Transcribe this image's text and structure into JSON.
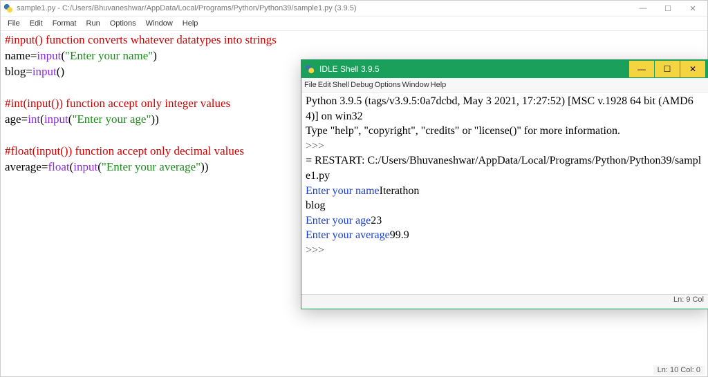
{
  "editor": {
    "title": "sample1.py - C:/Users/Bhuvaneshwar/AppData/Local/Programs/Python/Python39/sample1.py (3.9.5)",
    "menu": [
      "File",
      "Edit",
      "Format",
      "Run",
      "Options",
      "Window",
      "Help"
    ],
    "win_controls": {
      "min": "—",
      "max": "☐",
      "close": "✕"
    },
    "code": {
      "l1_comment": "#input() function converts whatever datatypes into strings",
      "l2_a": "name",
      "l2_b": "=",
      "l2_c": "input",
      "l2_d": "(",
      "l2_e": "\"Enter your name\"",
      "l2_f": ")",
      "l3_a": "blog",
      "l3_b": "=",
      "l3_c": "input",
      "l3_d": "(",
      "l3_e": ")",
      "l5_comment": "#int(input()) function accept only integer values",
      "l6_a": "age",
      "l6_b": "=",
      "l6_c": "int",
      "l6_d": "(",
      "l6_e": "input",
      "l6_f": "(",
      "l6_g": "\"Enter your age\"",
      "l6_h": ")",
      "l6_i": ")",
      "l8_comment": "#float(input()) function accept only decimal values",
      "l9_a": "average",
      "l9_b": "=",
      "l9_c": "float",
      "l9_d": "(",
      "l9_e": "input",
      "l9_f": "(",
      "l9_g": "\"Enter your average\"",
      "l9_h": ")",
      "l9_i": ")"
    },
    "status": "Ln: 10  Col: 0"
  },
  "shell": {
    "title": "IDLE Shell 3.9.5",
    "menu": [
      "File",
      "Edit",
      "Shell",
      "Debug",
      "Options",
      "Window",
      "Help"
    ],
    "win_controls": {
      "min": "—",
      "max": "☐",
      "close": "✕"
    },
    "banner1": "Python 3.9.5 (tags/v3.9.5:0a7dcbd, May  3 2021, 17:27:52) [MSC v.1928 64 bit (AMD64)] on win32",
    "banner2": "Type \"help\", \"copyright\", \"credits\" or \"license()\" for more information.",
    "prompt1": ">>> ",
    "restart": "= RESTART: C:/Users/Bhuvaneshwar/AppData/Local/Programs/Python/Python39/sample1.py",
    "line_name_prompt": "Enter your name",
    "line_name_input": "Iterathon",
    "line_blog_input": "blog",
    "line_age_prompt": "Enter your age",
    "line_age_input": "23",
    "line_avg_prompt": "Enter your average",
    "line_avg_input": "99.9",
    "prompt2": ">>> ",
    "status": "Ln: 9  Col"
  }
}
